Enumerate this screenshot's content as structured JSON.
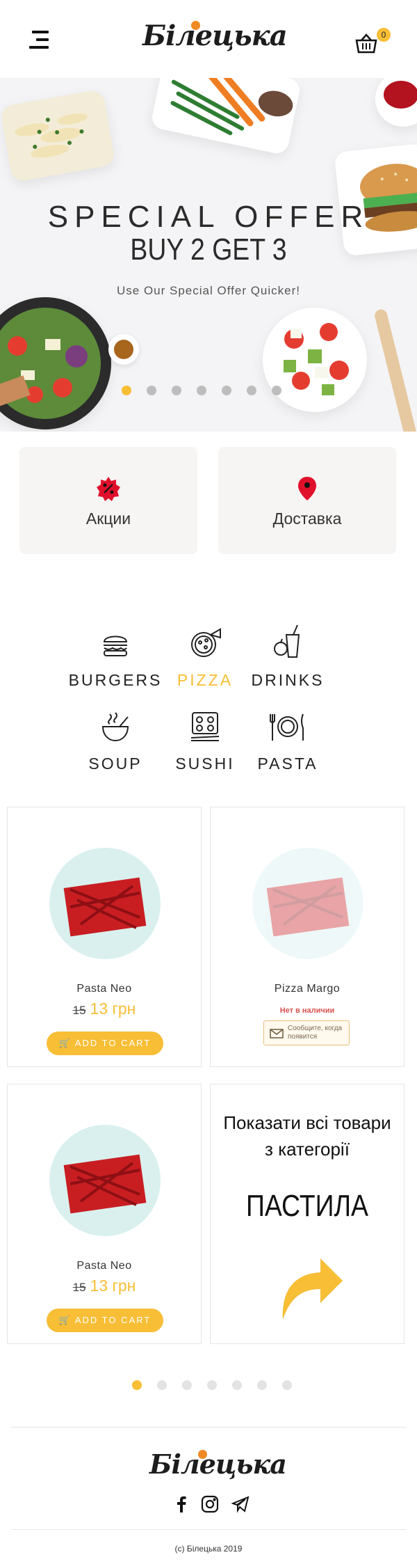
{
  "header": {
    "logo_text": "Білецька",
    "cart_count": "0"
  },
  "hero": {
    "title": "SPECIAL OFFER",
    "subtitle": "BUY 2 GET 3",
    "note": "Use Our Special Offer Quicker!",
    "slides_total": 7,
    "active_slide": 1
  },
  "quick_links": [
    {
      "label": "Акции",
      "icon": "discount-badge-icon"
    },
    {
      "label": "Доставка",
      "icon": "location-pin-icon"
    }
  ],
  "categories": [
    {
      "label": "BURGERS",
      "icon": "burger-icon",
      "active": false
    },
    {
      "label": "PIZZA",
      "icon": "pizza-icon",
      "active": true
    },
    {
      "label": "DRINKS",
      "icon": "drinks-icon",
      "active": false
    },
    {
      "label": "SOUP",
      "icon": "soup-icon",
      "active": false
    },
    {
      "label": "SUSHI",
      "icon": "sushi-icon",
      "active": false
    },
    {
      "label": "PASTA",
      "icon": "pasta-icon",
      "active": false
    }
  ],
  "products": [
    {
      "name": "Pasta Neo",
      "old_price": "15",
      "price": "13 грн",
      "button": "ADD TO CART"
    },
    {
      "name": "Pizza Margo",
      "status": "Нет в наличии",
      "notify": "Сообщите, когда появится"
    },
    {
      "name": "Pasta Neo",
      "old_price": "15",
      "price": "13 грн",
      "button": "ADD TO CART"
    }
  ],
  "promo": {
    "heading_line1": "Показати всі товари",
    "heading_line2": "з категорії",
    "category": "ПАСТИЛА"
  },
  "carousel": {
    "dots_total": 7,
    "active": 1
  },
  "footer": {
    "logo_text": "Білецька",
    "social": [
      "facebook-icon",
      "instagram-icon",
      "telegram-icon"
    ],
    "copyright": "(с) Білецька 2019"
  },
  "colors": {
    "accent": "#f7be36",
    "brand_orange": "#f08a24",
    "stock_red": "#d9534f",
    "pin_red": "#e0102a"
  }
}
